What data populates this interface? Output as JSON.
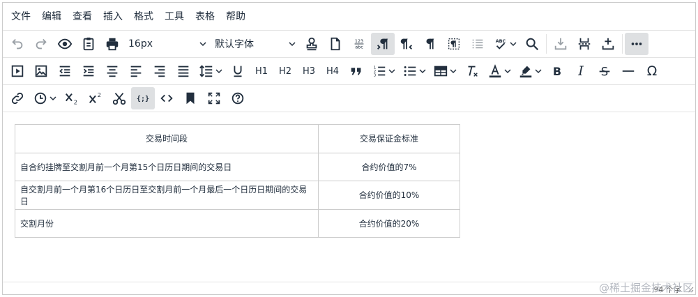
{
  "menubar": [
    "文件",
    "编辑",
    "查看",
    "插入",
    "格式",
    "工具",
    "表格",
    "帮助"
  ],
  "toolbar": {
    "font_size": "16px",
    "font_family": "默认字体",
    "h1": "H1",
    "h2": "H2",
    "h3": "H3",
    "h4": "H4",
    "bold": "B",
    "italic": "I",
    "strike": "S",
    "omega": "Ω",
    "abc": "ABC",
    "numbers_abc_top": "123",
    "numbers_abc_bottom": "abc",
    "code_sample": "{;}"
  },
  "table": {
    "header": [
      "交易时间段",
      "交易保证金标准"
    ],
    "rows": [
      [
        "自合约挂牌至交割月前一个月第15个日历日期间的交易日",
        "合约价值的7%"
      ],
      [
        "自交割月前一个月第16个日历日至交割月前一个月最后一个日历日期间的交易日",
        "合约价值的10%"
      ],
      [
        "交割月份",
        "合约价值的20%"
      ]
    ]
  },
  "status": {
    "word_count": "94 个字"
  },
  "watermark": "@稀土掘金技术社区",
  "colors": {
    "active_button": "#dee0e2",
    "icon": "#222f3e",
    "border": "#cccccc"
  }
}
